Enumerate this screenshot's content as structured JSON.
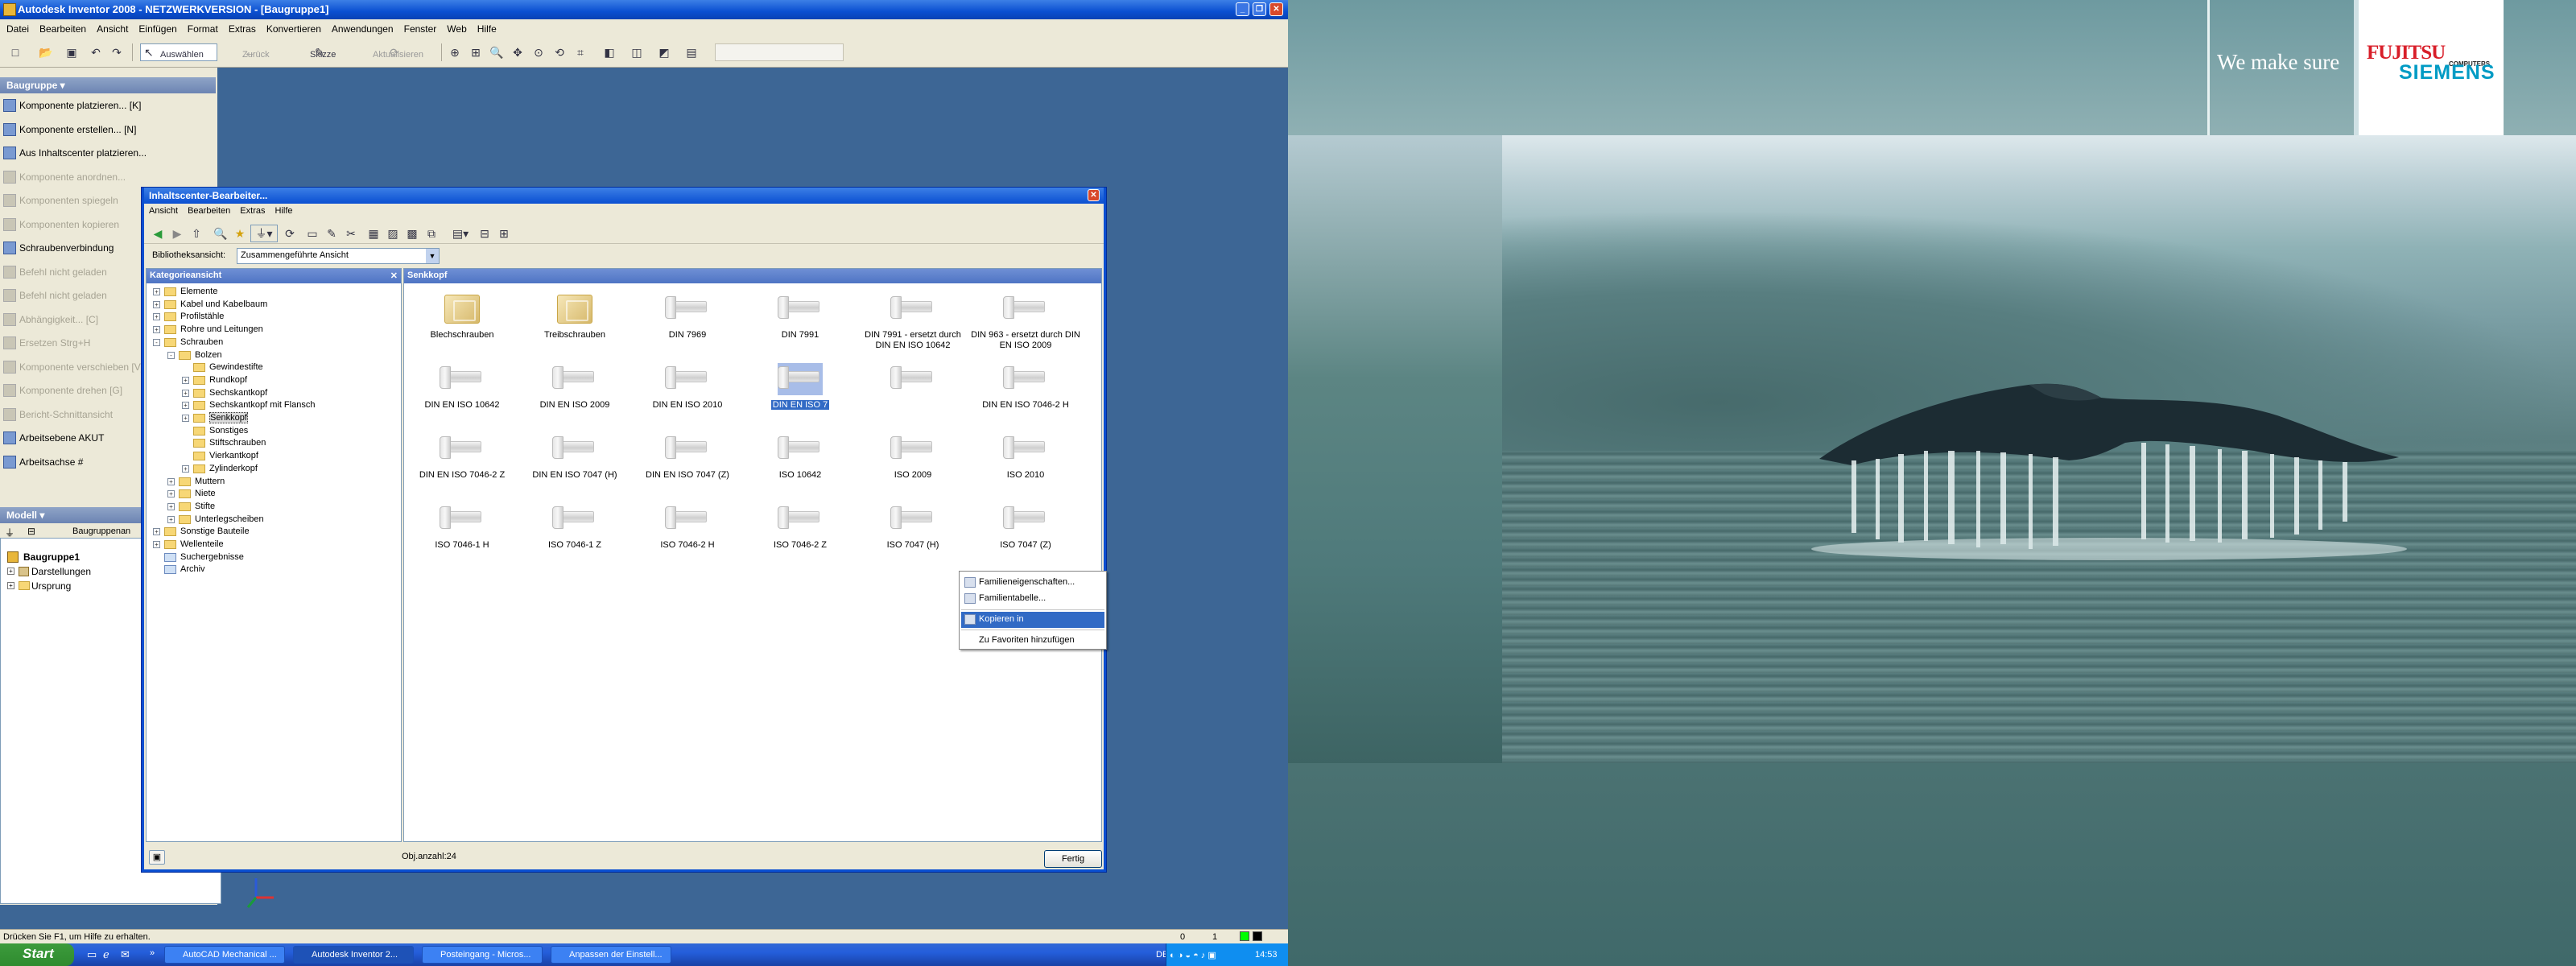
{
  "window": {
    "title": "Autodesk Inventor 2008 - NETZWERKVERSION - [Baugruppe1]"
  },
  "menu": [
    "Datei",
    "Bearbeiten",
    "Ansicht",
    "Einfügen",
    "Format",
    "Extras",
    "Konvertieren",
    "Anwendungen",
    "Fenster",
    "Web",
    "Hilfe"
  ],
  "toolbar": {
    "select_label": "Auswählen",
    "back_label": "Zurück",
    "sketch_label": "Skizze",
    "update_label": "Aktualisieren"
  },
  "panel": {
    "title": "Baugruppe ▾",
    "items": [
      {
        "label": "Komponente platzieren... [K]",
        "enabled": true
      },
      {
        "label": "Komponente erstellen... [N]",
        "enabled": true
      },
      {
        "label": "Aus Inhaltscenter platzieren...",
        "enabled": true
      },
      {
        "label": "Komponente anordnen...",
        "enabled": false
      },
      {
        "label": "Komponenten spiegeln",
        "enabled": false
      },
      {
        "label": "Komponenten kopieren",
        "enabled": false
      },
      {
        "label": "Schraubenverbindung",
        "enabled": true
      },
      {
        "label": "Befehl nicht geladen",
        "enabled": false
      },
      {
        "label": "Befehl nicht geladen",
        "enabled": false
      },
      {
        "label": "Abhängigkeit... [C]",
        "enabled": false
      },
      {
        "label": "Ersetzen Strg+H",
        "enabled": false
      },
      {
        "label": "Komponente verschieben [V]",
        "enabled": false
      },
      {
        "label": "Komponente drehen [G]",
        "enabled": false
      },
      {
        "label": "Bericht-Schnittansicht",
        "enabled": false
      },
      {
        "label": "Arbeitsebene AKUT",
        "enabled": true
      },
      {
        "label": "Arbeitsachse #",
        "enabled": true
      }
    ]
  },
  "model": {
    "title": "Modell ▾",
    "view_label": "Baugruppenan",
    "tree": [
      "Baugruppe1",
      "Darstellungen",
      "Ursprung"
    ]
  },
  "status": {
    "text": "Drücken Sie F1, um Hilfe zu erhalten.",
    "v1": "0",
    "v2": "1"
  },
  "dialog": {
    "title": "Inhaltscenter-Bearbeiter...",
    "menu": [
      "Ansicht",
      "Bearbeiten",
      "Extras",
      "Hilfe"
    ],
    "lib_label": "Bibliotheksansicht:",
    "lib_value": "Zusammengeführte Ansicht",
    "cat_header": "Kategorieansicht",
    "content_header": "Senkkopf",
    "count": "Obj.anzahl:24",
    "done": "Fertig",
    "tree": [
      {
        "label": "Elemente",
        "lvl": 0,
        "exp": "+"
      },
      {
        "label": "Kabel und Kabelbaum",
        "lvl": 0,
        "exp": "+"
      },
      {
        "label": "Profilstähle",
        "lvl": 0,
        "exp": "+"
      },
      {
        "label": "Rohre und Leitungen",
        "lvl": 0,
        "exp": "+"
      },
      {
        "label": "Schrauben",
        "lvl": 0,
        "exp": "-"
      },
      {
        "label": "Bolzen",
        "lvl": 1,
        "exp": "-"
      },
      {
        "label": "Gewindestifte",
        "lvl": 2,
        "exp": ""
      },
      {
        "label": "Rundkopf",
        "lvl": 2,
        "exp": "+"
      },
      {
        "label": "Sechskantkopf",
        "lvl": 2,
        "exp": "+"
      },
      {
        "label": "Sechskantkopf mit Flansch",
        "lvl": 2,
        "exp": "+"
      },
      {
        "label": "Senkkopf",
        "lvl": 2,
        "exp": "+",
        "sel": true
      },
      {
        "label": "Sonstiges",
        "lvl": 2,
        "exp": ""
      },
      {
        "label": "Stiftschrauben",
        "lvl": 2,
        "exp": ""
      },
      {
        "label": "Vierkantkopf",
        "lvl": 2,
        "exp": ""
      },
      {
        "label": "Zylinderkopf",
        "lvl": 2,
        "exp": "+"
      },
      {
        "label": "Muttern",
        "lvl": 1,
        "exp": "+"
      },
      {
        "label": "Niete",
        "lvl": 1,
        "exp": "+"
      },
      {
        "label": "Stifte",
        "lvl": 1,
        "exp": "+"
      },
      {
        "label": "Unterlegscheiben",
        "lvl": 1,
        "exp": "+"
      },
      {
        "label": "Sonstige Bauteile",
        "lvl": 0,
        "exp": "+"
      },
      {
        "label": "Wellenteile",
        "lvl": 0,
        "exp": "+"
      },
      {
        "label": "Suchergebnisse",
        "lvl": 0,
        "exp": ""
      },
      {
        "label": "Archiv",
        "lvl": 0,
        "exp": ""
      }
    ],
    "items": [
      {
        "label": "Blechschrauben",
        "kind": "crate"
      },
      {
        "label": "Treibschrauben",
        "kind": "crate"
      },
      {
        "label": "DIN 7969",
        "kind": "bolt"
      },
      {
        "label": "DIN 7991",
        "kind": "bolt"
      },
      {
        "label": "DIN 7991 - ersetzt durch DIN EN ISO 10642",
        "kind": "bolt"
      },
      {
        "label": "DIN 963 - ersetzt durch DIN EN ISO 2009",
        "kind": "bolt"
      },
      {
        "label": "DIN EN ISO 10642",
        "kind": "bolt"
      },
      {
        "label": "DIN EN ISO 2009",
        "kind": "bolt"
      },
      {
        "label": "DIN EN ISO 2010",
        "kind": "bolt"
      },
      {
        "label": "DIN EN ISO 7",
        "kind": "bolt",
        "sel": true
      },
      {
        "label": "",
        "kind": "bolt"
      },
      {
        "label": "DIN EN ISO 7046-2 H",
        "kind": "bolt"
      },
      {
        "label": "DIN EN ISO 7046-2 Z",
        "kind": "bolt"
      },
      {
        "label": "DIN EN ISO 7047 (H)",
        "kind": "bolt"
      },
      {
        "label": "DIN EN ISO 7047 (Z)",
        "kind": "bolt"
      },
      {
        "label": "ISO 10642",
        "kind": "bolt"
      },
      {
        "label": "ISO 2009",
        "kind": "bolt"
      },
      {
        "label": "ISO 2010",
        "kind": "bolt"
      },
      {
        "label": "ISO 7046-1 H",
        "kind": "bolt"
      },
      {
        "label": "ISO 7046-1 Z",
        "kind": "bolt"
      },
      {
        "label": "ISO 7046-2 H",
        "kind": "bolt"
      },
      {
        "label": "ISO 7046-2 Z",
        "kind": "bolt"
      },
      {
        "label": "ISO 7047 (H)",
        "kind": "bolt"
      },
      {
        "label": "ISO 7047 (Z)",
        "kind": "bolt"
      }
    ],
    "context_menu": [
      "Familieneigenschaften...",
      "Familientabelle...",
      "Kopieren in",
      "Zu Favoriten hinzufügen"
    ]
  },
  "taskbar": {
    "start": "Start",
    "tasks": [
      "AutoCAD Mechanical ...",
      "Autodesk Inventor 2...",
      "Posteingang - Micros...",
      "Anpassen der Einstell..."
    ],
    "lang": "DE",
    "time": "14:53"
  },
  "wallpaper": {
    "slogan": "We make sure",
    "brand_top": "FUJITSU",
    "brand_sub": "COMPUTERS",
    "brand_bottom": "SIEMENS"
  }
}
